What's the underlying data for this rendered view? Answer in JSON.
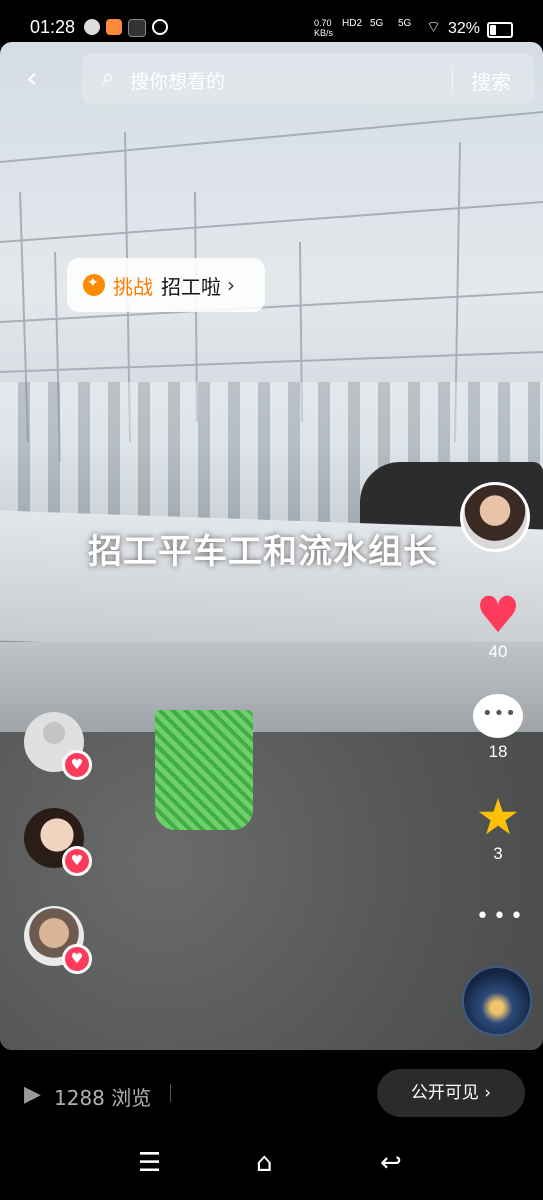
{
  "status_bar": {
    "time": "01:28",
    "net_speed": "0.70",
    "net_unit": "KB/s",
    "hd_label": "HD2",
    "signal1": "5G",
    "signal2": "5G",
    "battery": "32%"
  },
  "top_bar": {
    "search_placeholder": "搜你想看的",
    "search_button": "搜索"
  },
  "challenge_chip": {
    "tag": "挑战",
    "topic": "招工啦",
    "arrow": "›"
  },
  "video": {
    "caption": "招工平车工和流水组长"
  },
  "actions": {
    "likes": "40",
    "comments": "18",
    "favorites": "3",
    "more": "•••"
  },
  "bottom_bar": {
    "views": "1288 浏览",
    "visibility_button": "公开可见 ›"
  },
  "nav_bar": {
    "menu": "☰",
    "home": "⌂",
    "back": "↩"
  },
  "colors": {
    "like_red": "#ff3b5c",
    "star_yellow": "#ffc107",
    "challenge_orange": "#ff7a00"
  }
}
